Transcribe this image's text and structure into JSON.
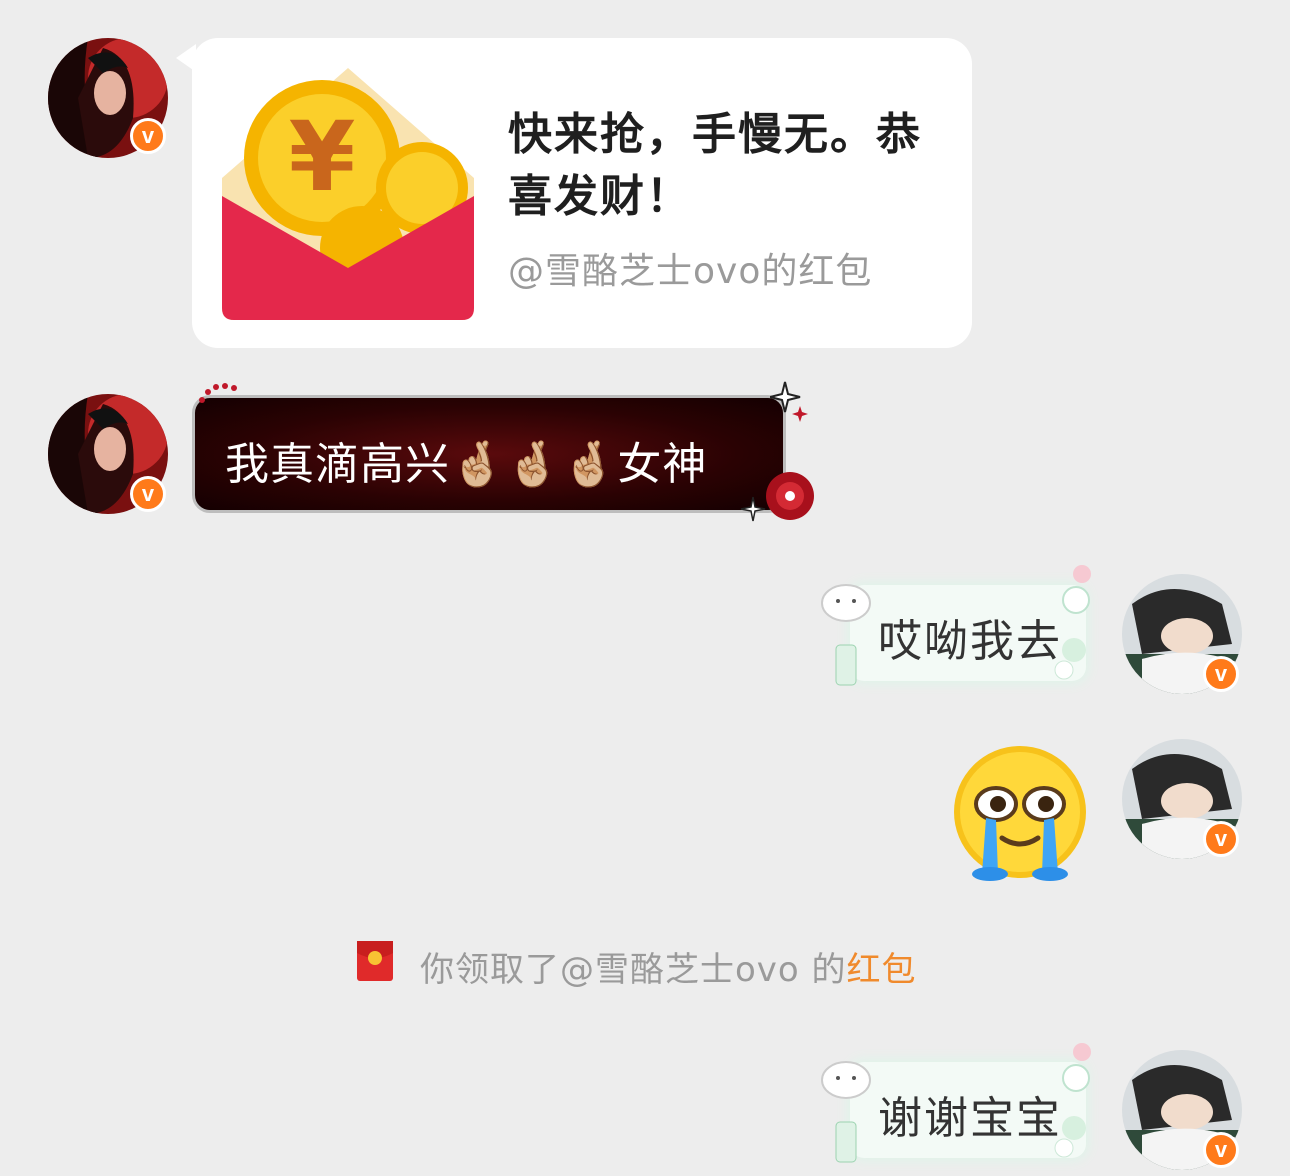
{
  "messages": {
    "red_packet": {
      "title": "快来抢，手慢无。恭喜发财！",
      "subtitle": "@雪酪芝士ovo的红包"
    },
    "text_1": {
      "text": "我真滴高兴🤞🏼🤞🏼🤞🏼女神"
    },
    "text_2": {
      "text": "哎呦我去"
    },
    "sticker": {
      "icon": "crying-laughing-emoji-icon"
    },
    "system": {
      "prefix": "你领取了@雪酪芝士ovo 的",
      "link": "红包"
    },
    "text_3": {
      "text": "谢谢宝宝"
    }
  },
  "colors": {
    "background": "#ededed",
    "verified_badge": "#ff7a1a",
    "link": "#f08a2c",
    "red_envelope": "#e4284b",
    "coin": "#f7c21b"
  }
}
